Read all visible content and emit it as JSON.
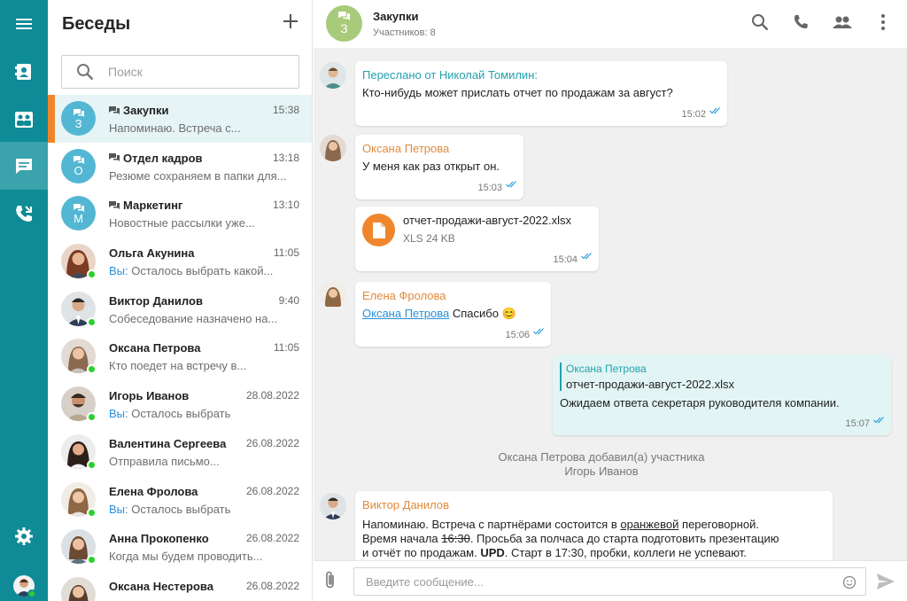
{
  "sidebar": {
    "icons": [
      "menu-icon",
      "contacts-icon",
      "directory-icon",
      "chats-icon",
      "calls-icon",
      "settings-icon"
    ],
    "accent": "#0e8b96"
  },
  "conversations": {
    "title": "Беседы",
    "search_placeholder": "Поиск",
    "items": [
      {
        "name": "Закупки",
        "time": "15:38",
        "preview": "Напоминаю. Встреча с...",
        "letter": "З",
        "group": true
      },
      {
        "name": "Отдел кадров",
        "time": "13:18",
        "preview": "Резюме сохраняем в папки для...",
        "letter": "О",
        "group": true
      },
      {
        "name": "Маркетинг",
        "time": "13:10",
        "preview": "Новостные рассылки уже...",
        "letter": "М",
        "group": true
      },
      {
        "name": "Ольга Акунина",
        "time": "11:05",
        "me": "Вы:",
        "preview": "Осталось выбрать какой...",
        "online": true
      },
      {
        "name": "Виктор Данилов",
        "time": "9:40",
        "preview": "Собеседование назначено на...",
        "online": true
      },
      {
        "name": "Оксана Петрова",
        "time": "11:05",
        "preview": "Кто поедет на встречу в...",
        "online": true
      },
      {
        "name": "Игорь Иванов",
        "time": "28.08.2022",
        "me": "Вы:",
        "preview": "Осталось выбрать",
        "online": true
      },
      {
        "name": "Валентина Сергеева",
        "time": "26.08.2022",
        "preview": "Отправила письмо...",
        "online": true
      },
      {
        "name": "Елена Фролова",
        "time": "26.08.2022",
        "me": "Вы:",
        "preview": "Осталось выбрать",
        "online": true
      },
      {
        "name": "Анна Прокопенко",
        "time": "26.08.2022",
        "preview": "Когда мы будем проводить...",
        "online": true
      },
      {
        "name": "Оксана Нестерова",
        "time": "26.08.2022",
        "preview": "",
        "online": false
      }
    ]
  },
  "chat": {
    "title": "Закупки",
    "subtitle": "Участников: 8",
    "avatar_letter": "З",
    "messages": {
      "m1": {
        "author": "Переслано от Николай Томилин:",
        "text": "Кто-нибудь может прислать отчет по продажам за август?",
        "time": "15:02"
      },
      "m2": {
        "author": "Оксана Петрова",
        "text": "У меня как раз открыт он.",
        "time": "15:03"
      },
      "m3": {
        "file_name": "отчет-продажи-август-2022.xlsx",
        "file_size": "XLS 24 KB",
        "time": "15:04"
      },
      "m4": {
        "author": "Елена Фролова",
        "mention": "Оксана Петрова",
        "text": "Спасибо 😊",
        "time": "15:06"
      },
      "m5": {
        "quote_author": "Оксана Петрова",
        "quote_text": "отчет-продажи-август-2022.xlsx",
        "text": "Ожидаем ответа секретаря руководителя компании.",
        "time": "15:07"
      },
      "system_line1": "Оксана Петрова добавил(а) участника",
      "system_line2": "Игорь Иванов",
      "m6": {
        "author": "Виктор Данилов",
        "l1_a": "Напоминаю. Встреча с партнёрами состоится в ",
        "l1_u": "оранжевой",
        "l1_b": " переговорной.",
        "l2_a": "Время начала ",
        "l2_s": "16:30",
        "l2_b": ". Просьба за полчаса до старта подготовить презентацию",
        "l3_a": "и отчёт по продажам. ",
        "l3_bold": "UPD",
        "l3_b": ". Старт в 17:30, пробки, коллеги не успевают."
      }
    },
    "composer_placeholder": "Введите сообщение..."
  }
}
